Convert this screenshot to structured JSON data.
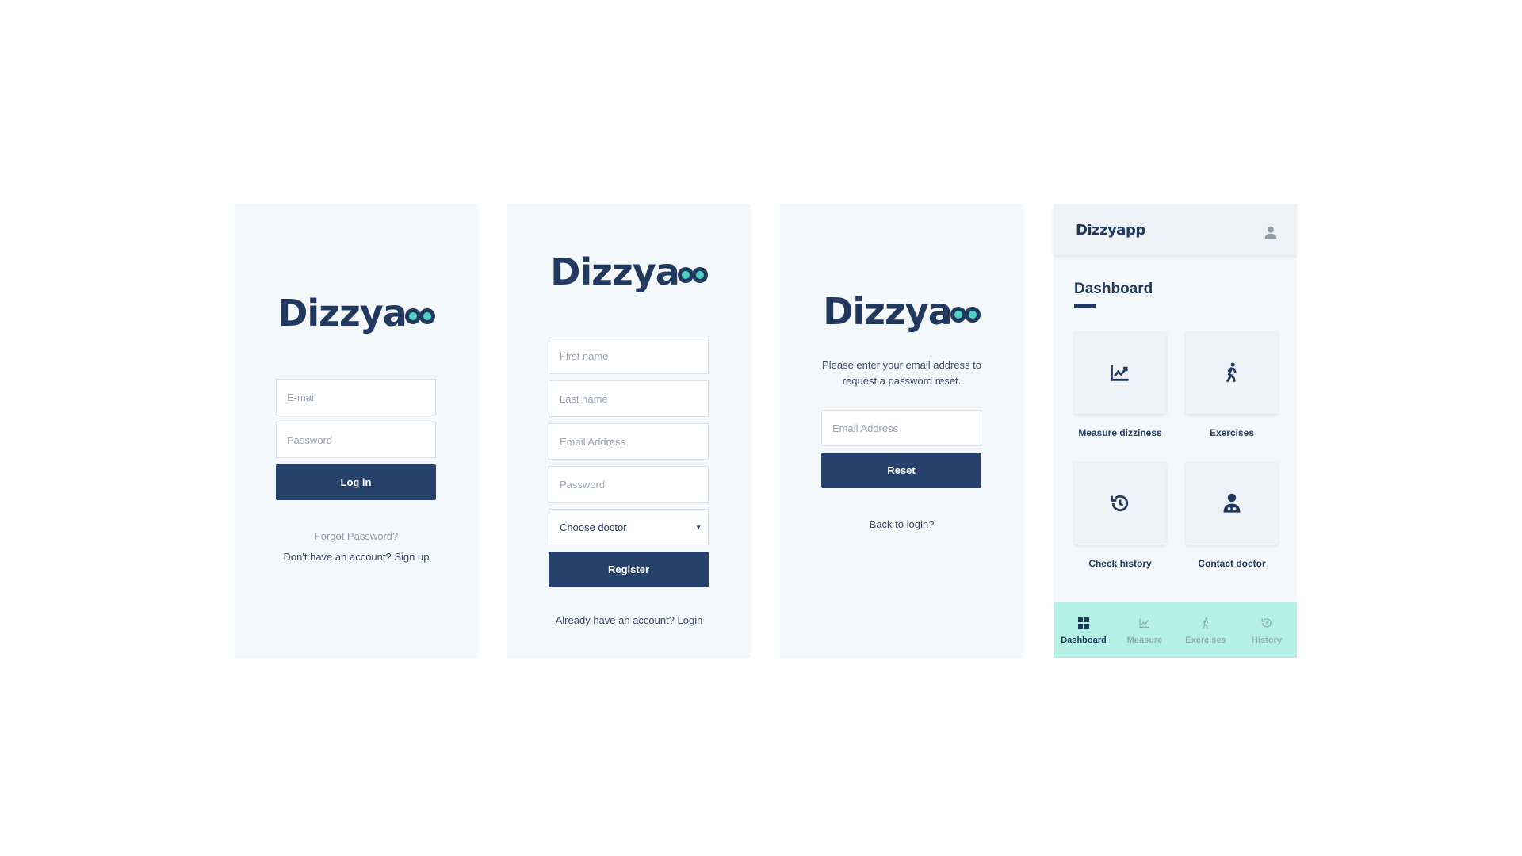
{
  "brand": {
    "name_main": "Dizzya",
    "name_tail": "p",
    "accent_color": "#4fd1c5",
    "primary_color": "#26416a"
  },
  "login": {
    "email_placeholder": "E-mail",
    "password_placeholder": "Password",
    "login_button": "Log in",
    "forgot_link": "Forgot Password?",
    "signup_link": "Don't have an account? Sign up"
  },
  "register": {
    "first_name_placeholder": "First name",
    "last_name_placeholder": "Last name",
    "email_placeholder": "Email Address",
    "password_placeholder": "Password",
    "doctor_select": "Choose doctor",
    "register_button": "Register",
    "login_link": "Already have an account? Login"
  },
  "reset": {
    "instructions": "Please enter your email address to request a password reset.",
    "email_placeholder": "Email Address",
    "reset_button": "Reset",
    "back_link": "Back to login?"
  },
  "dashboard": {
    "topbar_logo": "Dizzyapp",
    "title": "Dashboard",
    "tiles": [
      {
        "label": "Measure dizziness",
        "icon": "chart-line-icon"
      },
      {
        "label": "Exercises",
        "icon": "walking-icon"
      },
      {
        "label": "Check history",
        "icon": "history-icon"
      },
      {
        "label": "Contact doctor",
        "icon": "doctor-icon"
      }
    ],
    "nav": [
      {
        "label": "Dashboard",
        "icon": "grid-icon",
        "active": true
      },
      {
        "label": "Measure",
        "icon": "chart-line-icon",
        "active": false
      },
      {
        "label": "Exercises",
        "icon": "walking-icon",
        "active": false
      },
      {
        "label": "History",
        "icon": "history-icon",
        "active": false
      }
    ]
  }
}
